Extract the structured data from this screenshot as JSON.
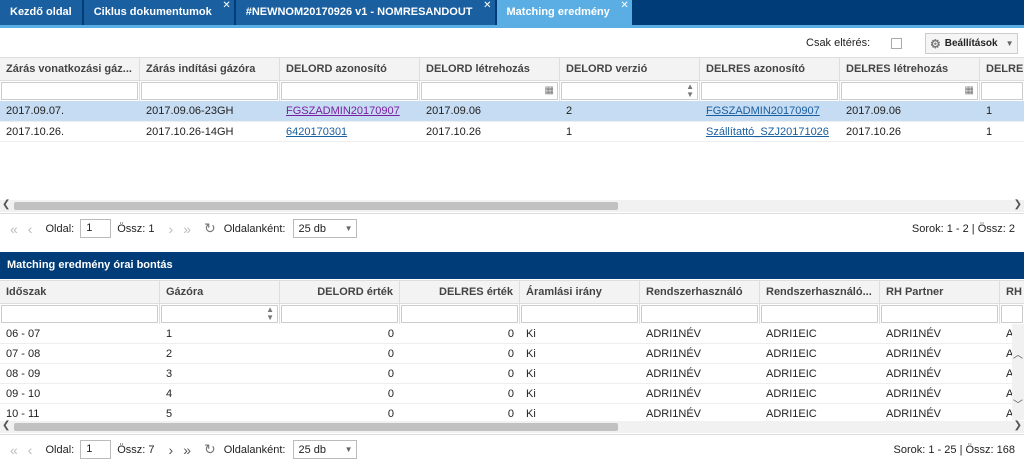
{
  "tabs": [
    {
      "label": "Kezdő oldal",
      "closable": false,
      "active": false
    },
    {
      "label": "Ciklus dokumentumok",
      "closable": true,
      "active": false
    },
    {
      "label": "#NEWNOM20170926 v1 - NOMRESANDOUT",
      "closable": true,
      "active": false
    },
    {
      "label": "Matching eredmény",
      "closable": true,
      "active": true
    }
  ],
  "toolbar": {
    "only_diff_label": "Csak eltérés:",
    "only_diff_checked": false,
    "settings_label": "Beállítások"
  },
  "grid1": {
    "columns": [
      {
        "label": "Zárás vonatkozási gáz...",
        "filter": "none"
      },
      {
        "label": "Zárás indítási gázóra",
        "filter": "none"
      },
      {
        "label": "DELORD azonosító",
        "filter": "none"
      },
      {
        "label": "DELORD létrehozás",
        "filter": "calendar"
      },
      {
        "label": "DELORD verzió",
        "filter": "spinner"
      },
      {
        "label": "DELRES azonosító",
        "filter": "none"
      },
      {
        "label": "DELRES létrehozás",
        "filter": "calendar"
      },
      {
        "label": "DELRE",
        "filter": "none"
      }
    ],
    "rows": [
      {
        "selected": true,
        "cells": [
          "2017.09.07.",
          "2017.09.06-23GH",
          "FGSZADMIN20170907",
          "2017.09.06",
          "2",
          "FGSZADMIN20170907",
          "2017.09.06",
          "1"
        ]
      },
      {
        "selected": false,
        "cells": [
          "2017.10.26.",
          "2017.10.26-14GH",
          "6420170301",
          "2017.10.26",
          "1",
          "Szállítattó_SZJ20171026",
          "2017.10.26",
          "1"
        ]
      }
    ],
    "pager": {
      "page_label": "Oldal:",
      "page_value": "1",
      "total_label": "Össz: 1",
      "per_page_label": "Oldalanként:",
      "per_page_value": "25 db",
      "rows_info": "Sorok: 1 - 2 | Össz: 2"
    }
  },
  "section_title": "Matching eredmény órai bontás",
  "grid2": {
    "columns": [
      {
        "label": "Időszak",
        "filter": "none"
      },
      {
        "label": "Gázóra",
        "filter": "spinner"
      },
      {
        "label": "DELORD érték",
        "filter": "none"
      },
      {
        "label": "DELRES érték",
        "filter": "none"
      },
      {
        "label": "Áramlási irány",
        "filter": "none"
      },
      {
        "label": "Rendszerhasználó",
        "filter": "none"
      },
      {
        "label": "Rendszerhasználó...",
        "filter": "none"
      },
      {
        "label": "RH Partner",
        "filter": "none"
      },
      {
        "label": "RH",
        "filter": "none"
      }
    ],
    "rows": [
      [
        "06 - 07",
        "1",
        "0",
        "0",
        "Ki",
        "ADRI1NÉV",
        "ADRI1EIC",
        "ADRI1NÉV",
        "A"
      ],
      [
        "07 - 08",
        "2",
        "0",
        "0",
        "Ki",
        "ADRI1NÉV",
        "ADRI1EIC",
        "ADRI1NÉV",
        "A"
      ],
      [
        "08 - 09",
        "3",
        "0",
        "0",
        "Ki",
        "ADRI1NÉV",
        "ADRI1EIC",
        "ADRI1NÉV",
        "A"
      ],
      [
        "09 - 10",
        "4",
        "0",
        "0",
        "Ki",
        "ADRI1NÉV",
        "ADRI1EIC",
        "ADRI1NÉV",
        "A"
      ],
      [
        "10 - 11",
        "5",
        "0",
        "0",
        "Ki",
        "ADRI1NÉV",
        "ADRI1EIC",
        "ADRI1NÉV",
        "A"
      ]
    ],
    "pager": {
      "page_label": "Oldal:",
      "page_value": "1",
      "total_label": "Össz: 7",
      "per_page_label": "Oldalanként:",
      "per_page_value": "25 db",
      "rows_info": "Sorok: 1 - 25 | Össz: 168"
    }
  },
  "icons": {
    "first": "first-page-icon",
    "prev": "prev-page-icon",
    "next": "next-page-icon",
    "last": "last-page-icon",
    "refresh": "refresh-icon",
    "gear": "gear-icon",
    "calendar": "calendar-icon",
    "spinner": "spinner-icon"
  },
  "colors": {
    "header_bg": "#003c77",
    "tab_bg": "#1a5fa0",
    "tab_active_bg": "#5aaee3",
    "selected_row": "#c6dcf2",
    "link": "#1a5fa0",
    "visited_link": "#7b1fa2"
  }
}
